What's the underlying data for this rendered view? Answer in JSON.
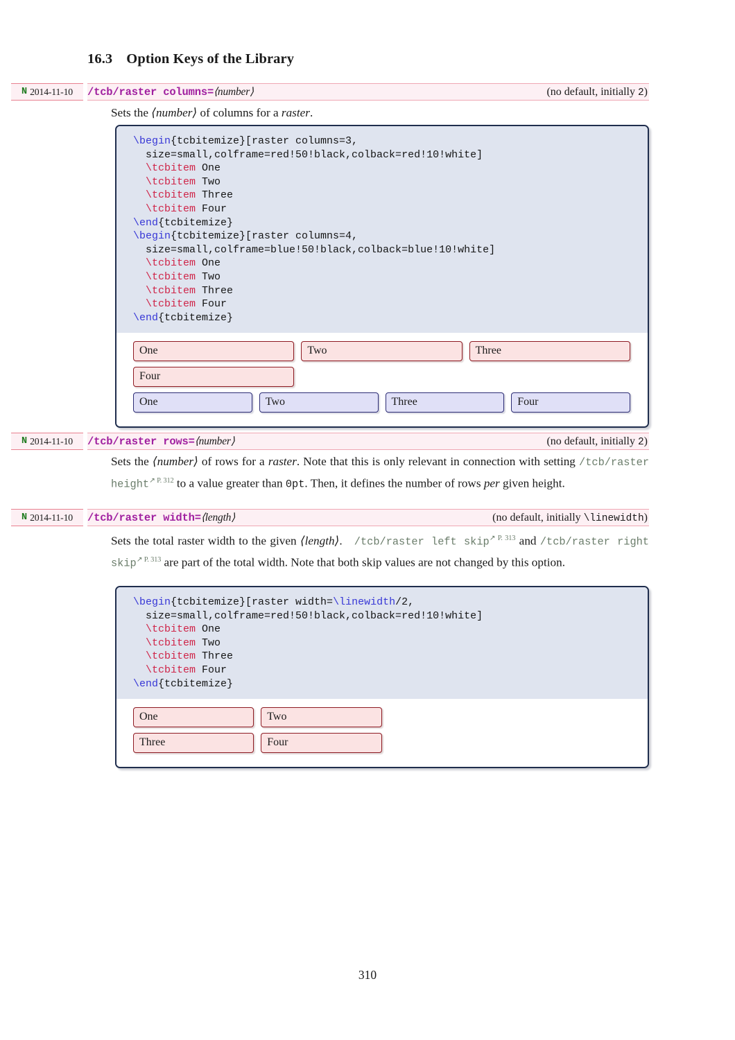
{
  "document": {
    "section": {
      "number": "16.3",
      "title": "Option Keys of the Library"
    },
    "page_number": "310"
  },
  "entries": [
    {
      "marker": {
        "flag": "N",
        "date": "2014-11-10"
      },
      "key": "/tcb/raster columns",
      "equals": "=",
      "arg": "⟨number⟩",
      "default": "(no default, initially ",
      "default_value": "2",
      "default_tail": ")",
      "description_before": "Sets the ",
      "description_arg": "⟨number⟩",
      "description_mid": " of columns for a ",
      "description_em": "raster",
      "description_end": "."
    },
    {
      "marker": {
        "flag": "N",
        "date": "2014-11-10"
      },
      "key": "/tcb/raster rows",
      "equals": "=",
      "arg": "⟨number⟩",
      "default": "(no default, initially ",
      "default_value": "2",
      "default_tail": ")",
      "p1_a": "Sets the ",
      "p1_arg": "⟨number⟩",
      "p1_b": " of rows for a ",
      "p1_em": "raster",
      "p1_c": ". Note that this is only relevant in connection with setting ",
      "p1_ref": "/tcb/raster height",
      "p1_refsup": "↗ P. 312",
      "p1_d": " to a value greater than ",
      "p1_tt": "0pt",
      "p1_e": ". Then, it defines the number of rows ",
      "p1_em2": "per",
      "p1_f": " given height."
    },
    {
      "marker": {
        "flag": "N",
        "date": "2014-11-10"
      },
      "key": "/tcb/raster width",
      "equals": "=",
      "arg": "⟨length⟩",
      "default": "(no default, initially ",
      "default_value": "\\linewidth",
      "default_tail": ")",
      "p1_a": "Sets the total raster width to the given ",
      "p1_arg": "⟨length⟩",
      "p1_b": ". ",
      "p1_ref": "/tcb/raster left skip",
      "p1_refsup": "↗ P. 313",
      "p1_c": " and ",
      "p1_ref2": "/tcb/raster right skip",
      "p1_refsup2": "↗ P. 313",
      "p1_d": " are part of the total width. Note that both skip values are not changed by this option."
    }
  ],
  "examples": [
    {
      "code_lines": [
        {
          "parts": [
            {
              "t": "\\begin",
              "c": "blue"
            },
            {
              "t": "{tcbitemize}[raster columns=3,",
              "c": "plain"
            }
          ]
        },
        {
          "parts": [
            {
              "t": "  size=small,colframe=red!50!black,colback=red!10!white]",
              "c": "plain"
            }
          ]
        },
        {
          "parts": [
            {
              "t": "  ",
              "c": "plain"
            },
            {
              "t": "\\tcbitem",
              "c": "red"
            },
            {
              "t": " One",
              "c": "plain"
            }
          ]
        },
        {
          "parts": [
            {
              "t": "  ",
              "c": "plain"
            },
            {
              "t": "\\tcbitem",
              "c": "red"
            },
            {
              "t": " Two",
              "c": "plain"
            }
          ]
        },
        {
          "parts": [
            {
              "t": "  ",
              "c": "plain"
            },
            {
              "t": "\\tcbitem",
              "c": "red"
            },
            {
              "t": " Three",
              "c": "plain"
            }
          ]
        },
        {
          "parts": [
            {
              "t": "  ",
              "c": "plain"
            },
            {
              "t": "\\tcbitem",
              "c": "red"
            },
            {
              "t": " Four",
              "c": "plain"
            }
          ]
        },
        {
          "parts": [
            {
              "t": "\\end",
              "c": "blue"
            },
            {
              "t": "{tcbitemize}",
              "c": "plain"
            }
          ]
        },
        {
          "parts": [
            {
              "t": "\\begin",
              "c": "blue"
            },
            {
              "t": "{tcbitemize}[raster columns=4,",
              "c": "plain"
            }
          ]
        },
        {
          "parts": [
            {
              "t": "  size=small,colframe=blue!50!black,colback=blue!10!white]",
              "c": "plain"
            }
          ]
        },
        {
          "parts": [
            {
              "t": "  ",
              "c": "plain"
            },
            {
              "t": "\\tcbitem",
              "c": "red"
            },
            {
              "t": " One",
              "c": "plain"
            }
          ]
        },
        {
          "parts": [
            {
              "t": "  ",
              "c": "plain"
            },
            {
              "t": "\\tcbitem",
              "c": "red"
            },
            {
              "t": " Two",
              "c": "plain"
            }
          ]
        },
        {
          "parts": [
            {
              "t": "  ",
              "c": "plain"
            },
            {
              "t": "\\tcbitem",
              "c": "red"
            },
            {
              "t": " Three",
              "c": "plain"
            }
          ]
        },
        {
          "parts": [
            {
              "t": "  ",
              "c": "plain"
            },
            {
              "t": "\\tcbitem",
              "c": "red"
            },
            {
              "t": " Four",
              "c": "plain"
            }
          ]
        },
        {
          "parts": [
            {
              "t": "\\end",
              "c": "blue"
            },
            {
              "t": "{tcbitemize}",
              "c": "plain"
            }
          ]
        }
      ],
      "result_rows": [
        {
          "style": "red",
          "cols": 3,
          "items": [
            "One",
            "Two",
            "Three"
          ]
        },
        {
          "style": "red",
          "cols": 3,
          "items": [
            "Four"
          ]
        },
        {
          "style": "blue",
          "cols": 4,
          "items": [
            "One",
            "Two",
            "Three",
            "Four"
          ]
        }
      ]
    },
    {
      "code_lines": [
        {
          "parts": [
            {
              "t": "\\begin",
              "c": "blue"
            },
            {
              "t": "{tcbitemize}[raster width=",
              "c": "plain"
            },
            {
              "t": "\\linewidth",
              "c": "blue"
            },
            {
              "t": "/2,",
              "c": "plain"
            }
          ]
        },
        {
          "parts": [
            {
              "t": "  size=small,colframe=red!50!black,colback=red!10!white]",
              "c": "plain"
            }
          ]
        },
        {
          "parts": [
            {
              "t": "  ",
              "c": "plain"
            },
            {
              "t": "\\tcbitem",
              "c": "red"
            },
            {
              "t": " One",
              "c": "plain"
            }
          ]
        },
        {
          "parts": [
            {
              "t": "  ",
              "c": "plain"
            },
            {
              "t": "\\tcbitem",
              "c": "red"
            },
            {
              "t": " Two",
              "c": "plain"
            }
          ]
        },
        {
          "parts": [
            {
              "t": "  ",
              "c": "plain"
            },
            {
              "t": "\\tcbitem",
              "c": "red"
            },
            {
              "t": " Three",
              "c": "plain"
            }
          ]
        },
        {
          "parts": [
            {
              "t": "  ",
              "c": "plain"
            },
            {
              "t": "\\tcbitem",
              "c": "red"
            },
            {
              "t": " Four",
              "c": "plain"
            }
          ]
        },
        {
          "parts": [
            {
              "t": "\\end",
              "c": "blue"
            },
            {
              "t": "{tcbitemize}",
              "c": "plain"
            }
          ]
        }
      ],
      "result_rows": [
        {
          "style": "red",
          "cols": 2,
          "items": [
            "One",
            "Two"
          ],
          "halfwidth": true
        },
        {
          "style": "red",
          "cols": 2,
          "items": [
            "Three",
            "Four"
          ],
          "halfwidth": true
        }
      ]
    }
  ],
  "colors": {
    "key_magenta": "#a020a0",
    "marker_green": "#1e7a1e",
    "marker_bg": "#fdf0f4",
    "marker_rule": "#e8808f",
    "box_frame": "#1f2d4d",
    "code_bg": "#dfe4ef",
    "code_blue": "#3737d6",
    "code_red": "#cf2448",
    "item_red_frame": "#8d1a22",
    "item_red_bg": "#fbe3e3",
    "item_blue_frame": "#2b2b74",
    "item_blue_bg": "#e0e0f7",
    "ref_green": "#6b7d6b"
  }
}
